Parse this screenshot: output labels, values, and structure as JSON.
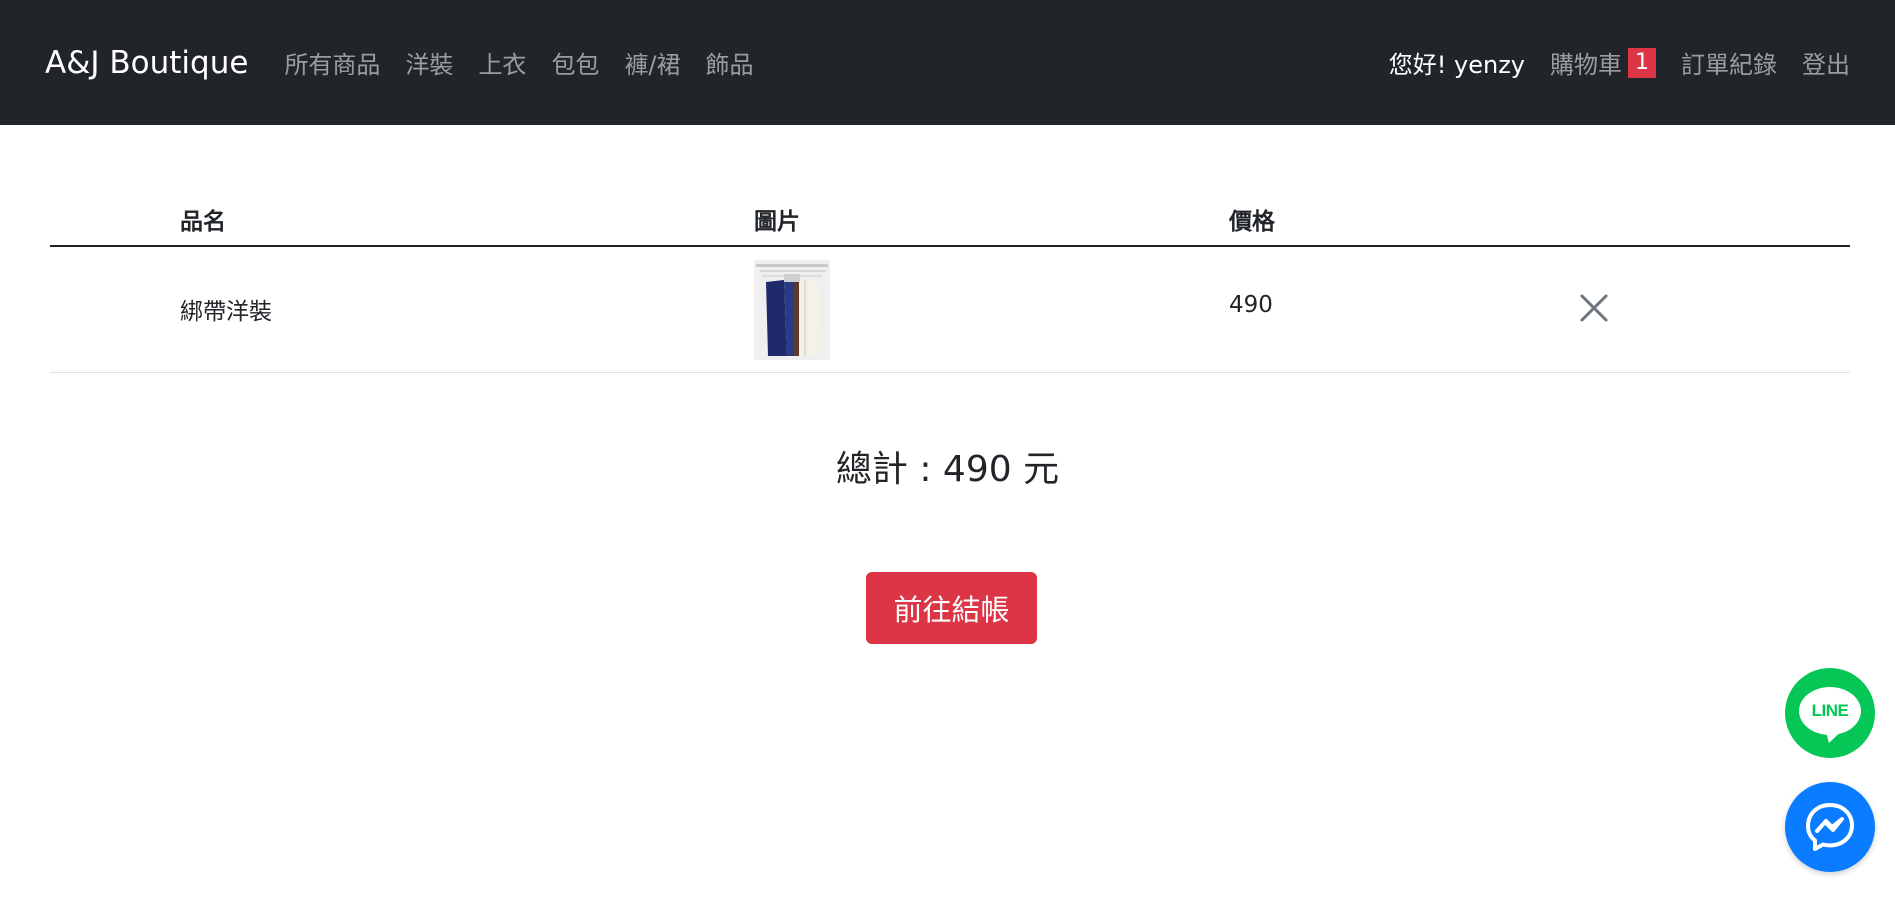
{
  "nav": {
    "brand": "A&J Boutique",
    "links": [
      "所有商品",
      "洋裝",
      "上衣",
      "包包",
      "褲/裙",
      "飾品"
    ],
    "greeting": "您好! yenzy",
    "cart_label": "購物車",
    "cart_count": "1",
    "orders_label": "訂單紀錄",
    "logout_label": "登出"
  },
  "table": {
    "headers": [
      "品名",
      "圖片",
      "價格"
    ],
    "rows": [
      {
        "name": "綁帶洋裝",
        "price": "490"
      }
    ]
  },
  "total_text": "總計 : 490 元",
  "checkout_label": "前往結帳",
  "line_label": "LINE",
  "colors": {
    "navbar_bg": "#212529",
    "accent_red": "#dc3545",
    "line_green": "#06c755",
    "messenger_blue": "#0a7cff"
  }
}
